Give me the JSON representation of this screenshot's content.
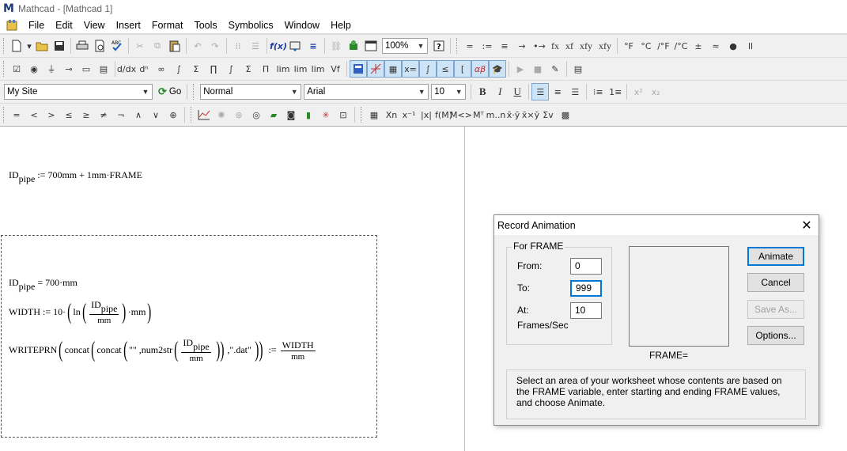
{
  "window": {
    "title": "Mathcad - [Mathcad 1]",
    "app_icon": "M"
  },
  "menu": [
    "File",
    "Edit",
    "View",
    "Insert",
    "Format",
    "Tools",
    "Symbolics",
    "Window",
    "Help"
  ],
  "toolbar_standard": {
    "zoom": "100%",
    "units": [
      "=",
      ":=",
      "≡",
      "→",
      "•→",
      "fx",
      "xf",
      "xfy",
      "xfy",
      "°F",
      "°C",
      "/°F",
      "/°C",
      "±",
      "≈",
      "●",
      "ll"
    ]
  },
  "toolbar_math_ops": {
    "labels": [
      "lim",
      "lim",
      "lim",
      "Vf",
      "x=",
      "αβ"
    ]
  },
  "toolbar_formatting": {
    "site": "My Site",
    "go_label": "Go",
    "style": "Normal",
    "font": "Arial",
    "size": "10",
    "bold": "B",
    "italic": "I",
    "underline": "U",
    "superscript": "x²",
    "subscript": "x₂"
  },
  "toolbar_boolean": {
    "symbols": [
      "=",
      "<",
      ">",
      "≤",
      "≥",
      "≠",
      "¬",
      "∧",
      "∨",
      "⊕"
    ],
    "matrix_labels": [
      "Xn",
      "x⁻¹",
      "|x|",
      "M<>",
      "Mᵀ",
      "m..n",
      "x̄·ȳ",
      "x̄×ȳ",
      "Σv"
    ]
  },
  "worksheet": {
    "eq1": {
      "lhs": "ID",
      "lhs_sub": "pipe",
      "op": ":=",
      "rhs": "700mm + 1mm·FRAME"
    },
    "eq2": {
      "lhs": "ID",
      "lhs_sub": "pipe",
      "op": "=",
      "rhs": "700·mm"
    },
    "eq3": {
      "lhs": "WIDTH",
      "op": ":=",
      "coef": "10·",
      "fn": "ln",
      "num": "ID",
      "num_sub": "pipe",
      "den": "mm",
      "tail": "·mm"
    },
    "eq4": {
      "fn": "WRITEPRN",
      "concat1": "concat",
      "concat2": "concat",
      "str1": "\"\"",
      "num2str": ",num2str",
      "num": "ID",
      "num_sub": "pipe",
      "den": "mm",
      "str2": ",\".dat\"",
      "op": ":=",
      "rnum": "WIDTH",
      "rden": "mm"
    }
  },
  "dialog": {
    "title": "Record Animation",
    "group_label": "For FRAME",
    "from_label": "From:",
    "from_value": "0",
    "to_label": "To:",
    "to_value": "999",
    "at_label": "At:",
    "at_value": "10",
    "fps_label": "Frames/Sec",
    "frame_label": "FRAME=",
    "animate": "Animate",
    "cancel": "Cancel",
    "save_as": "Save As...",
    "options": "Options...",
    "info": "Select an area of your worksheet whose contents are based on the FRAME variable, enter starting and ending FRAME values, and choose Animate."
  }
}
